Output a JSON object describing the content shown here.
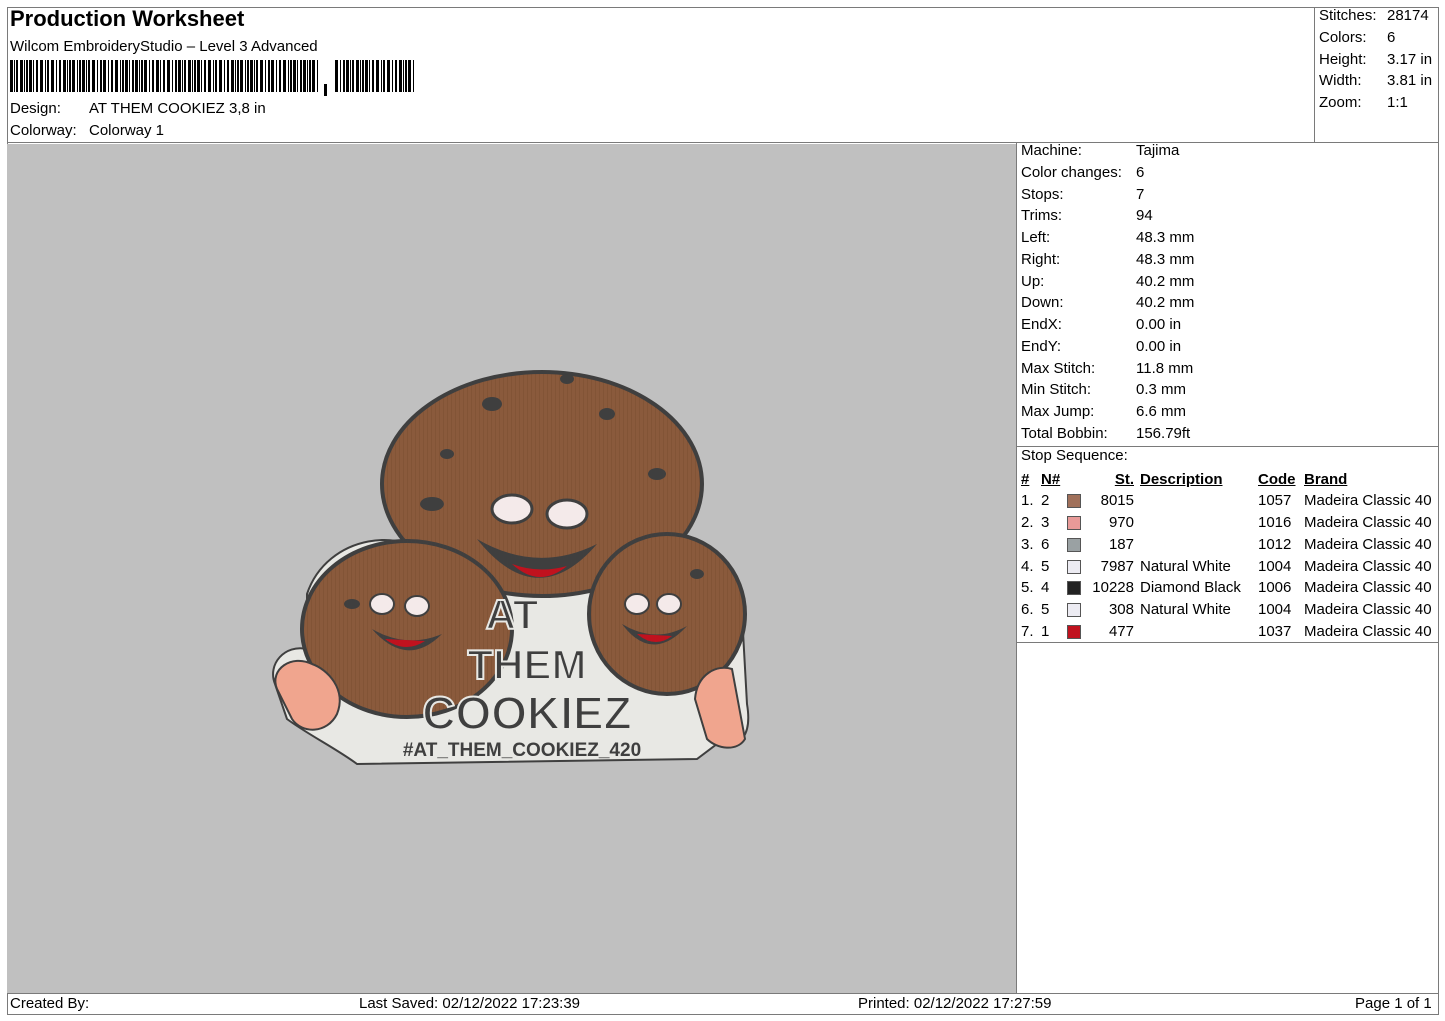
{
  "header": {
    "title": "Production Worksheet",
    "software": "Wilcom EmbroideryStudio – Level 3 Advanced",
    "design_label": "Design:",
    "design_value": "AT THEM COOKIEZ 3,8 in",
    "colorway_label": "Colorway:",
    "colorway_value": "Colorway 1"
  },
  "summary": [
    {
      "label": "Stitches:",
      "value": "28174"
    },
    {
      "label": "Colors:",
      "value": "6"
    },
    {
      "label": "Height:",
      "value": "3.17 in"
    },
    {
      "label": "Width:",
      "value": "3.81 in"
    },
    {
      "label": "Zoom:",
      "value": "1:1"
    }
  ],
  "machine_info": [
    {
      "label": "Machine:",
      "value": "Tajima"
    },
    {
      "label": "Color changes:",
      "value": "6"
    },
    {
      "label": "Stops:",
      "value": "7"
    },
    {
      "label": "Trims:",
      "value": "94"
    },
    {
      "label": "Left:",
      "value": "48.3 mm"
    },
    {
      "label": "Right:",
      "value": "48.3 mm"
    },
    {
      "label": "Up:",
      "value": "40.2 mm"
    },
    {
      "label": "Down:",
      "value": "40.2 mm"
    },
    {
      "label": "EndX:",
      "value": "0.00 in"
    },
    {
      "label": "EndY:",
      "value": "0.00 in"
    },
    {
      "label": "Max Stitch:",
      "value": "11.8 mm"
    },
    {
      "label": "Min Stitch:",
      "value": "0.3 mm"
    },
    {
      "label": "Max Jump:",
      "value": "6.6 mm"
    },
    {
      "label": "Total Bobbin:",
      "value": "156.79ft"
    }
  ],
  "stop_sequence": {
    "title": "Stop Sequence:",
    "headers": {
      "num": "#",
      "n": "N#",
      "st": "St.",
      "desc": "Description",
      "code": "Code",
      "brand": "Brand"
    },
    "rows": [
      {
        "num": "1.",
        "n": "2",
        "color": "#a0705a",
        "st": "8015",
        "desc": "",
        "code": "1057",
        "brand": "Madeira Classic 40"
      },
      {
        "num": "2.",
        "n": "3",
        "color": "#e89a98",
        "st": "970",
        "desc": "",
        "code": "1016",
        "brand": "Madeira Classic 40"
      },
      {
        "num": "3.",
        "n": "6",
        "color": "#9aa1a3",
        "st": "187",
        "desc": "",
        "code": "1012",
        "brand": "Madeira Classic 40"
      },
      {
        "num": "4.",
        "n": "5",
        "color": "#ecebf2",
        "st": "7987",
        "desc": "Natural White",
        "code": "1004",
        "brand": "Madeira Classic 40"
      },
      {
        "num": "5.",
        "n": "4",
        "color": "#222222",
        "st": "10228",
        "desc": "Diamond Black",
        "code": "1006",
        "brand": "Madeira Classic 40"
      },
      {
        "num": "6.",
        "n": "5",
        "color": "#ecebf2",
        "st": "308",
        "desc": "Natural White",
        "code": "1004",
        "brand": "Madeira Classic 40"
      },
      {
        "num": "7.",
        "n": "1",
        "color": "#c0121e",
        "st": "477",
        "desc": "",
        "code": "1037",
        "brand": "Madeira Classic 40"
      }
    ]
  },
  "design_text": {
    "line1": "AT",
    "line2": "THEM",
    "line3": "COOKIEZ",
    "hashtag": "#AT_THEM_COOKIEZ_420"
  },
  "footer": {
    "created_by": "Created By:",
    "last_saved": "Last Saved: 02/12/2022 17:23:39",
    "printed": "Printed: 02/12/2022 17:27:59",
    "page": "Page 1 of 1"
  },
  "colors": {
    "canvas": "#c0c0c0",
    "cookie": "#8a5a3c",
    "outline": "#3f3f3f"
  }
}
